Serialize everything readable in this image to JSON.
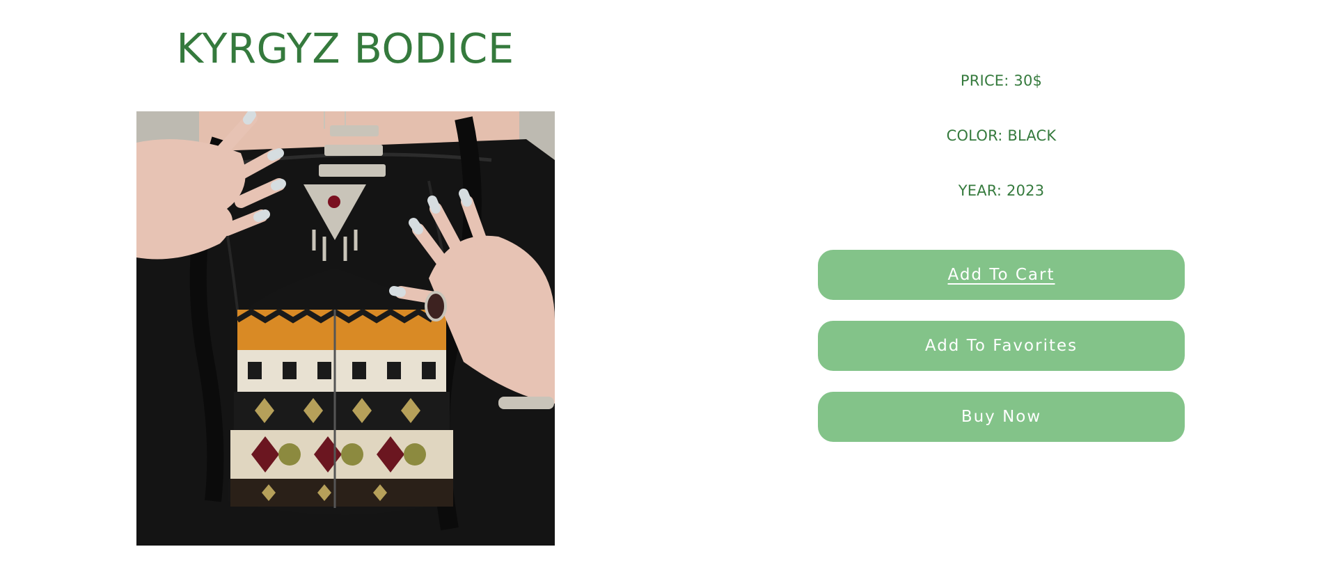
{
  "product": {
    "title": "KYRGYZ BODICE",
    "image": {
      "description_icon": "photo",
      "colors": {
        "background": "#bdbab1",
        "fabric": "#151515",
        "skin": "#e7c3b4",
        "nail": "#d6dde0",
        "silver": "#c9c4b9",
        "orange": "#d98a25",
        "cream": "#e8e1d2",
        "maroon": "#6b1620"
      }
    }
  },
  "details": {
    "price": "PRICE: 30$",
    "color": "COLOR: BLACK",
    "year": "YEAR: 2023"
  },
  "actions": {
    "add_to_cart": "Add To Cart",
    "add_to_favorites": "Add To Favorites",
    "buy_now": "Buy Now"
  },
  "theme": {
    "accent_text": "#357a3d",
    "button_bg": "#83c389",
    "button_text": "#ffffff"
  }
}
